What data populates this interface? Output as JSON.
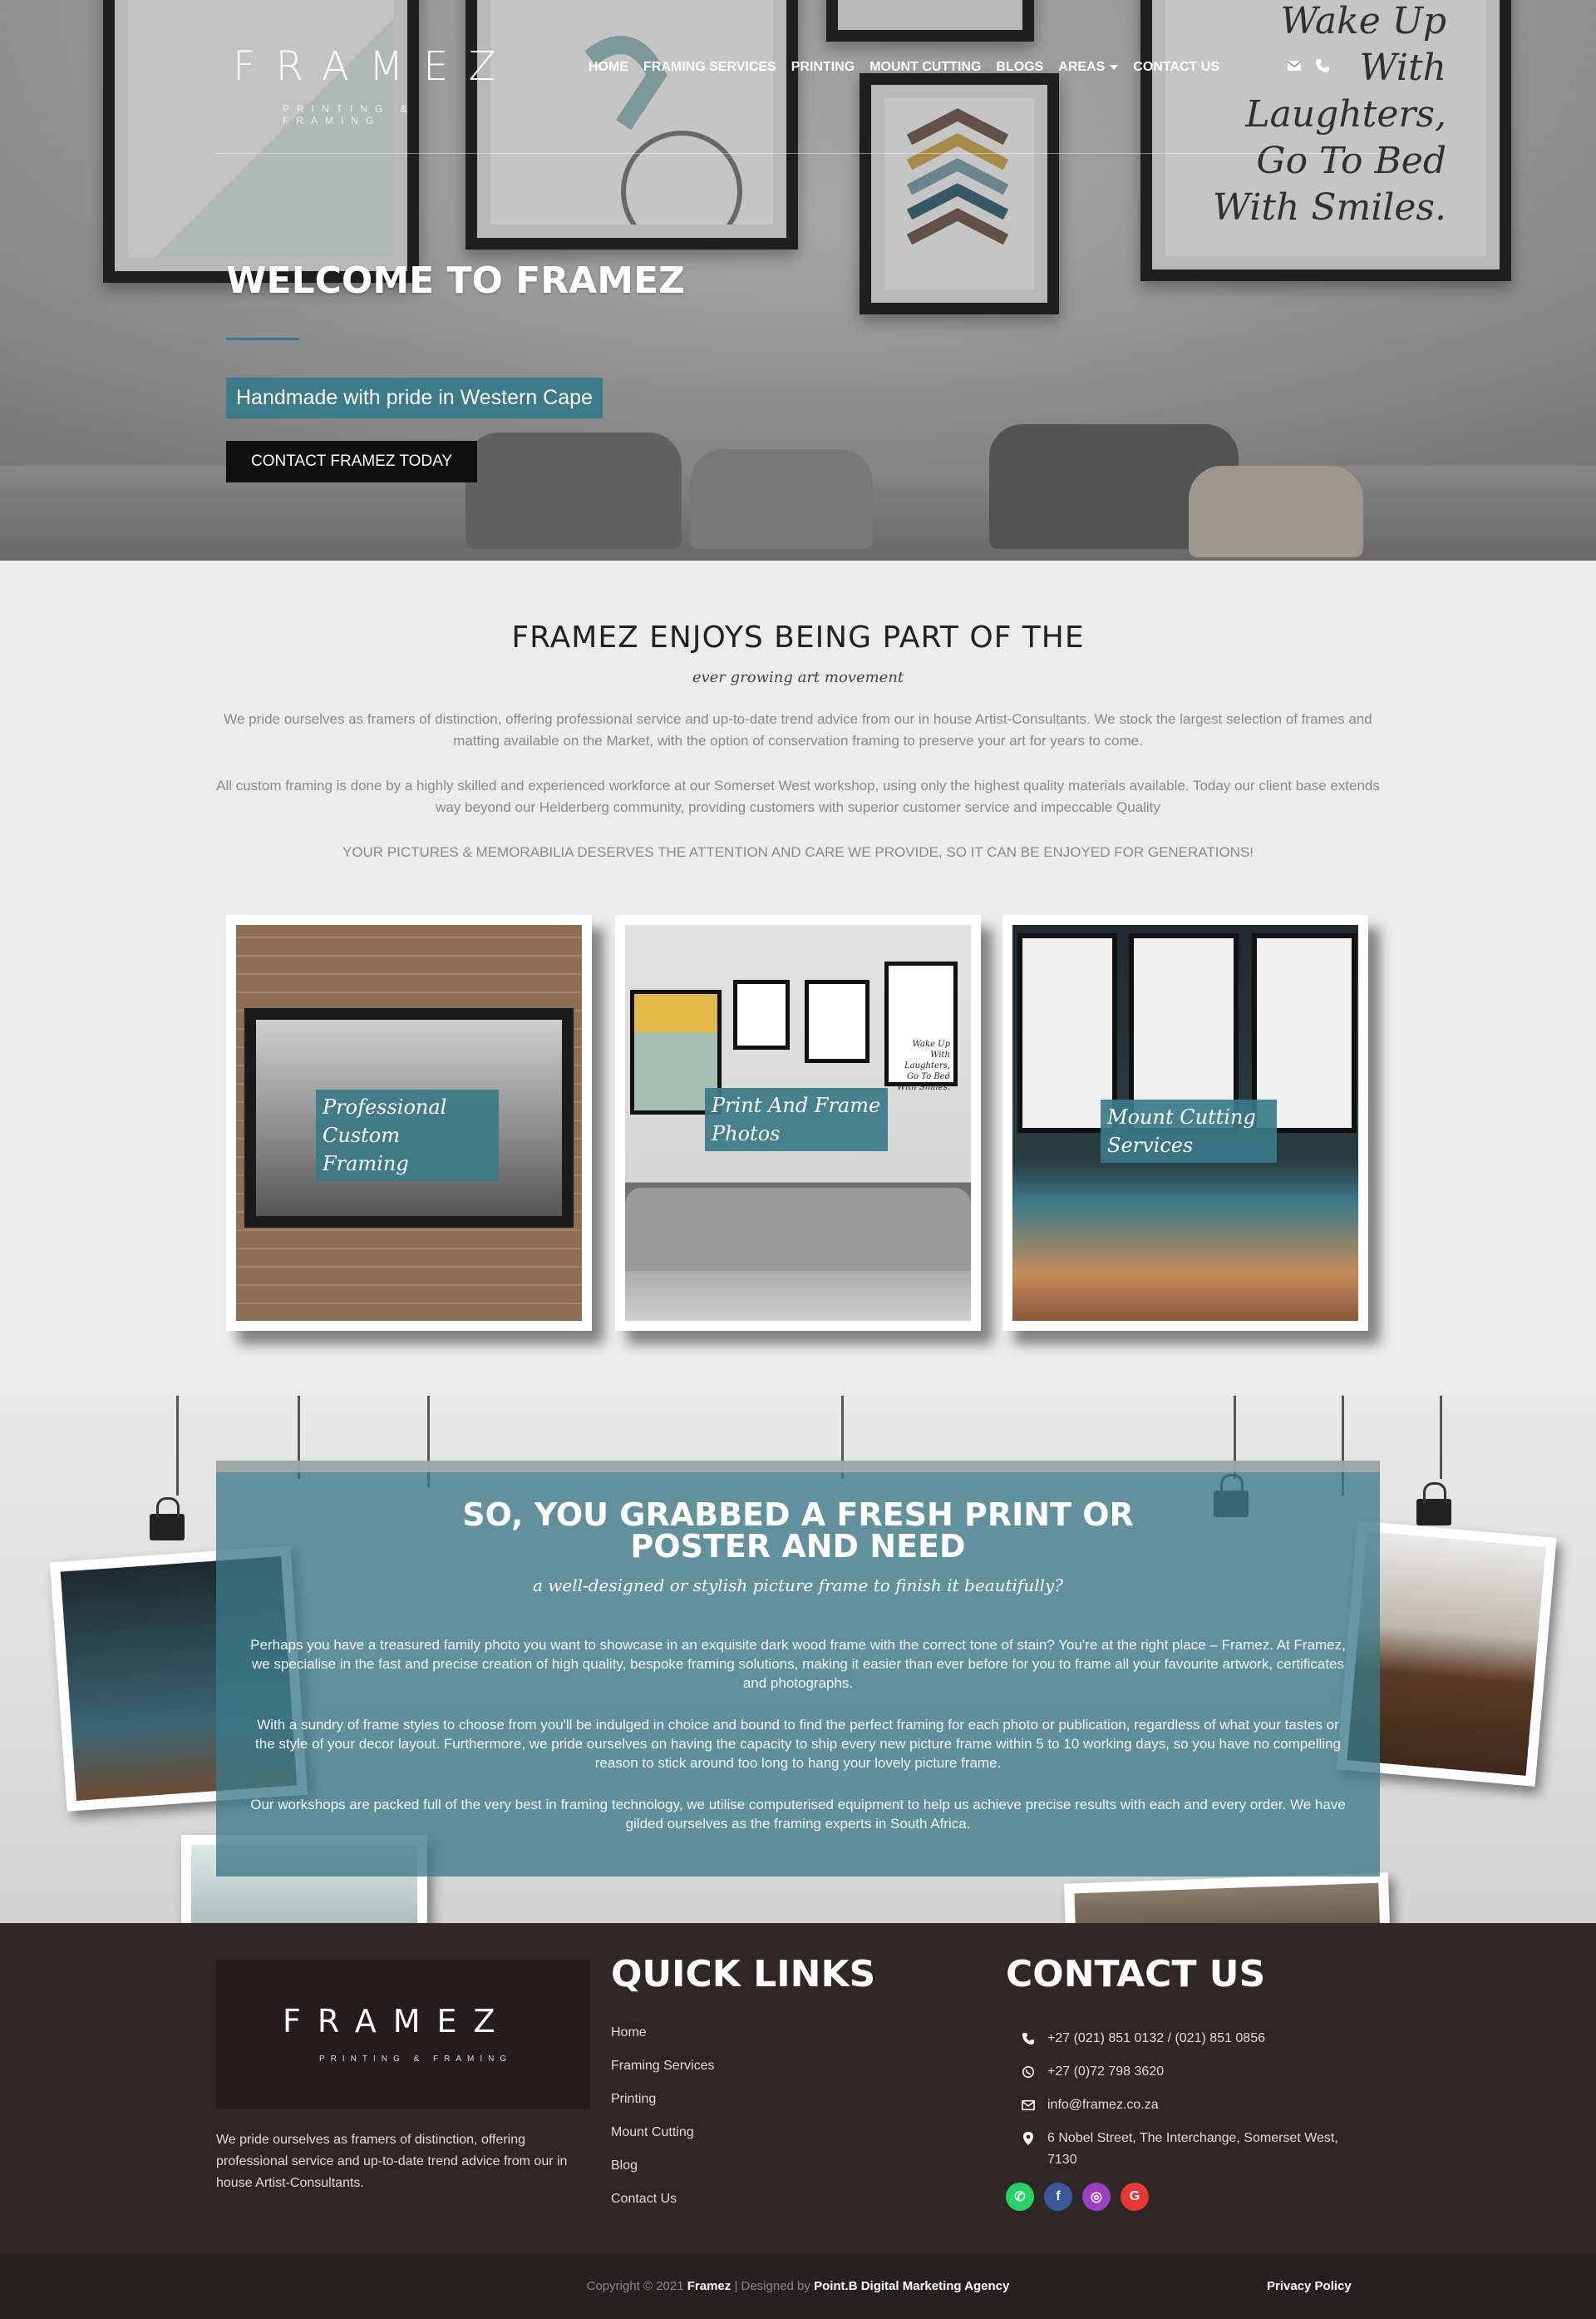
{
  "brand": {
    "logo_text": "FRAMEZ",
    "logo_sub": "PRINTING & FRAMING",
    "accent": "#3b7a88"
  },
  "nav": {
    "items": [
      "HOME",
      "FRAMING SERVICES",
      "PRINTING",
      "MOUNT CUTTING",
      "BLOGS",
      "AREAS",
      "CONTACT US"
    ],
    "icons": [
      "envelope-icon",
      "phone-icon"
    ]
  },
  "hero": {
    "title": "WELCOME TO FRAMEZ",
    "tagline": "Handmade with pride in Western Cape",
    "cta": "CONTACT FRAMEZ TODAY",
    "wall_art_text": "Wake Up With Laughters, Go To Bed With Smiles."
  },
  "intro": {
    "title": "FRAMEZ ENJOYS BEING PART OF THE",
    "subtitle": "ever growing art movement",
    "p1": "We pride ourselves as framers of distinction, offering professional service and up-to-date trend advice from our in house Artist-Consultants. We stock the largest selection of frames and matting available on the Market, with the option of conservation framing to preserve your art for years to come.",
    "p2": "All custom framing is done by a highly skilled and experienced workforce at our Somerset West workshop, using only the highest quality materials available. Today our client base extends way beyond our Helderberg community, providing customers with superior customer service and impeccable Quality",
    "p3": "YOUR PICTURES & MEMORABILIA DESERVES THE ATTENTION AND CARE WE PROVIDE, SO IT CAN BE ENJOYED FOR GENERATIONS!",
    "cards": [
      {
        "label": "Professional Custom Framing"
      },
      {
        "label": "Print And Frame Photos",
        "art_text": "Wake Up With Laughters, Go To Bed With Smiles."
      },
      {
        "label": "Mount Cutting Services"
      }
    ]
  },
  "promo": {
    "title_line1": "SO, YOU GRABBED A FRESH PRINT OR",
    "title_line2": "POSTER AND NEED",
    "subtitle": "a well-designed or stylish picture frame to finish it beautifully?",
    "p1": "Perhaps you have a treasured family photo you want to showcase in an exquisite dark wood frame with the correct tone of stain? You're at the right place – Framez. At Framez, we specialise in the fast and precise creation of high quality, bespoke framing solutions, making it easier than ever before for you to frame all your favourite artwork, certificates and photographs.",
    "p2": "With a sundry of frame styles to choose from you'll be indulged in choice and bound to find the perfect framing for each photo or publication, regardless of what your tastes or the style of your decor layout. Furthermore, we pride ourselves on having the capacity to ship every new picture frame within 5 to 10 working days, so you have no compelling reason to stick around too long to hang your lovely picture frame.",
    "p3": "Our workshops are packed full of the very best in framing technology, we utilise computerised equipment to help us achieve precise results with each and every order. We have gilded ourselves as the framing experts in South Africa."
  },
  "footer": {
    "about": "We pride ourselves as framers of distinction, offering professional service and up-to-date trend advice from our in house Artist-Consultants.",
    "quick_links_title": "QUICK LINKS",
    "quick_links": [
      "Home",
      "Framing Services",
      "Printing",
      "Mount Cutting",
      "Blog",
      "Contact Us"
    ],
    "contact_title": "CONTACT US",
    "phone": "+27 (021) 851 0132 / (021) 851 0856",
    "whatsapp": "+27 (0)72 798 3620",
    "email": "info@framez.co.za",
    "address": "6 Nobel Street, The Interchange, Somerset West, 7130",
    "socials": [
      {
        "name": "whatsapp-icon",
        "color": "#25d366"
      },
      {
        "name": "facebook-icon",
        "color": "#3b5998"
      },
      {
        "name": "instagram-icon",
        "color": "#9b3fc2"
      },
      {
        "name": "google-icon",
        "color": "#e53935"
      }
    ]
  },
  "bottom": {
    "copy_prefix": "Copyright © 2021",
    "brand": "Framez",
    "designed_by": "| Designed by",
    "agency": "Point.B Digital Marketing Agency",
    "privacy": "Privacy Policy"
  }
}
